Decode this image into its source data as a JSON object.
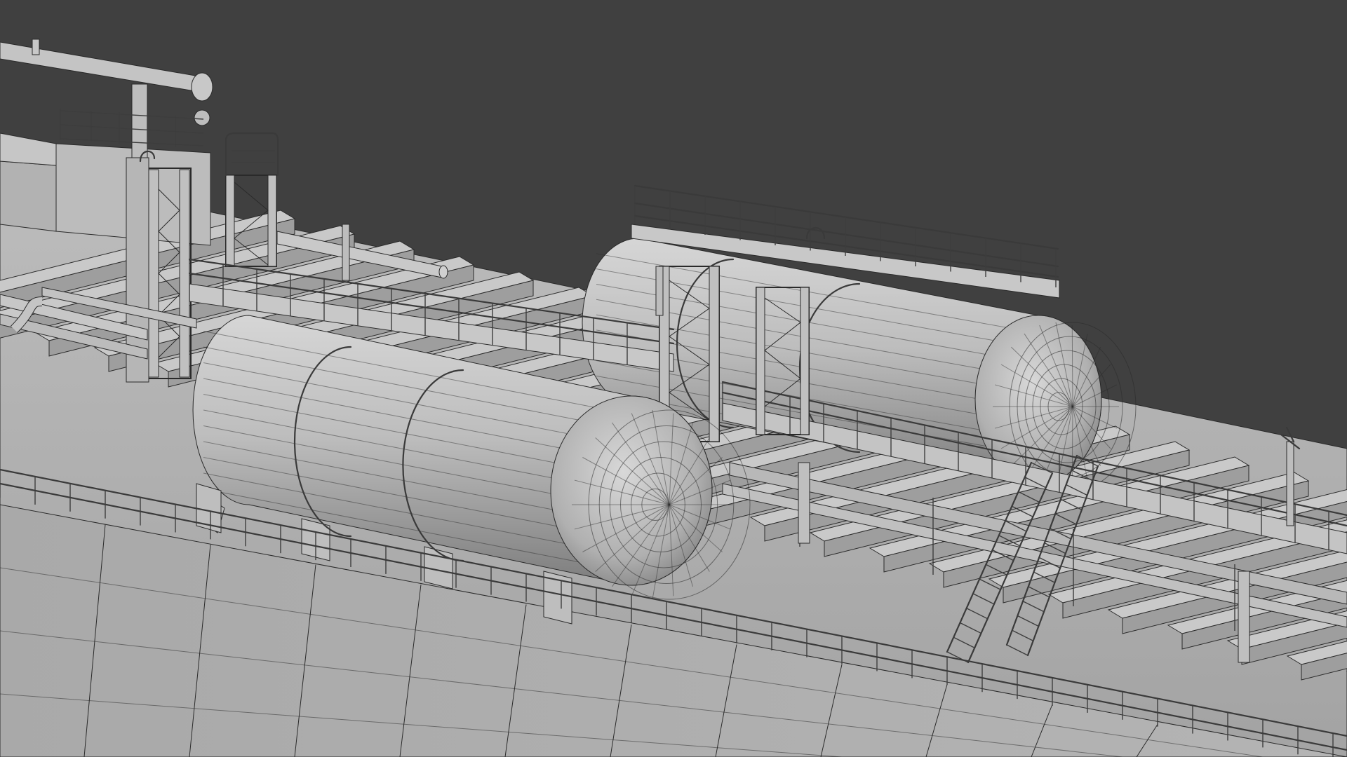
{
  "scene": {
    "background_color": "#404040",
    "model_base_color": "#b9b9b9",
    "wire_color": "#2a2a2a",
    "objects": [
      "deck-crane",
      "deck-housing",
      "pressure-tank-front",
      "pressure-tank-rear",
      "tank-top-platform-front",
      "tank-top-platform-rear",
      "support-tower-left",
      "support-tower-center",
      "support-tower-right",
      "pipe-rack",
      "catwalk",
      "access-ladder",
      "deck-railing",
      "hull-side-panels",
      "deck-web-frames",
      "vent-mast"
    ]
  }
}
